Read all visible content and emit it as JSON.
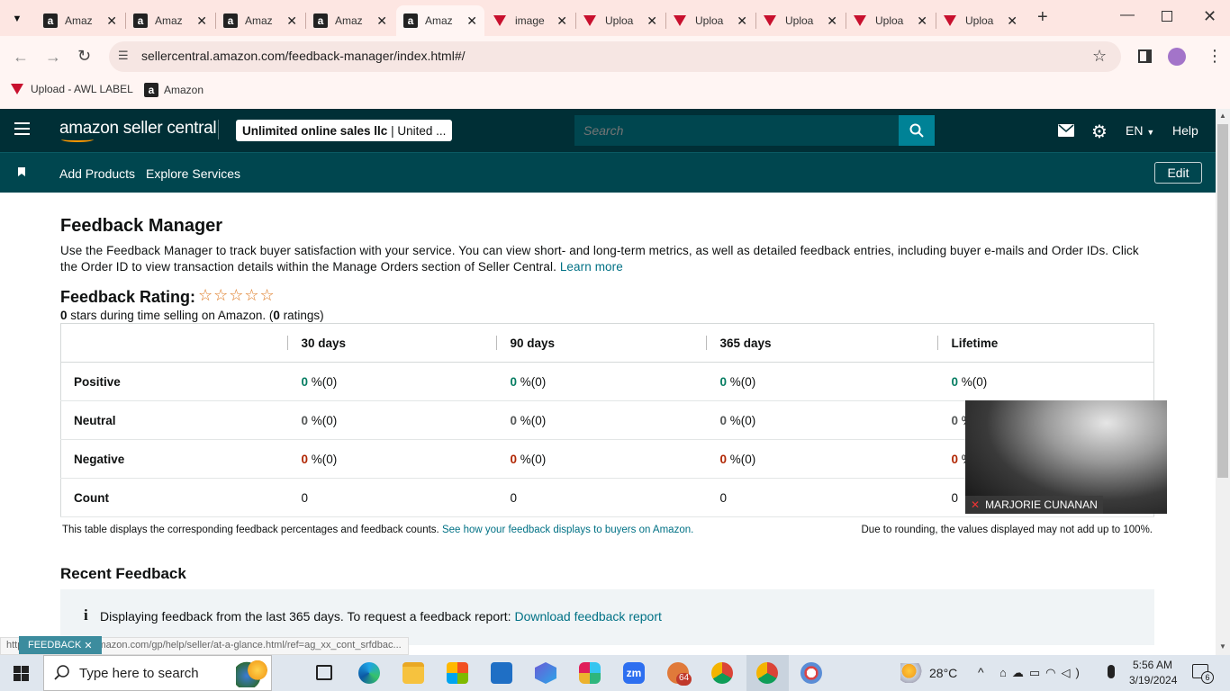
{
  "browser": {
    "tabs": [
      {
        "title": "Amaz",
        "icon": "amazon-icon",
        "active": false
      },
      {
        "title": "Amaz",
        "icon": "amazon-icon",
        "active": false
      },
      {
        "title": "Amaz",
        "icon": "amazon-icon",
        "active": false
      },
      {
        "title": "Amaz",
        "icon": "amazon-icon",
        "active": false
      },
      {
        "title": "Amaz",
        "icon": "amazon-icon",
        "active": true
      },
      {
        "title": "image",
        "icon": "upload-icon",
        "active": false
      },
      {
        "title": "Uploa",
        "icon": "upload-icon",
        "active": false
      },
      {
        "title": "Uploa",
        "icon": "upload-icon",
        "active": false
      },
      {
        "title": "Uploa",
        "icon": "upload-icon",
        "active": false
      },
      {
        "title": "Uploa",
        "icon": "upload-icon",
        "active": false
      },
      {
        "title": "Uploa",
        "icon": "upload-icon",
        "active": false
      }
    ],
    "url": "sellercentral.amazon.com/feedback-manager/index.html#/",
    "bookmarks": [
      "Upload - AWL LABEL",
      "Amazon"
    ],
    "status_url": "https://sellercentral.amazon.com/gp/help/seller/at-a-glance.html/ref=ag_xx_cont_srfdbac..."
  },
  "header": {
    "logo": "amazon seller central",
    "account": "Unlimited online sales llc",
    "account_region": "| United ...",
    "search_placeholder": "Search",
    "language": "EN",
    "help": "Help"
  },
  "nav": {
    "items": [
      "Add Products",
      "Explore Services"
    ],
    "edit": "Edit"
  },
  "page": {
    "title": "Feedback Manager",
    "description": "Use the Feedback Manager to track buyer satisfaction with your service. You can view short- and long-term metrics, as well as detailed feedback entries, including buyer e-mails and Order IDs. Click the Order ID to view transaction details within the Manage Orders section of Seller Central.",
    "learn_more": "Learn more",
    "rating_title": "Feedback Rating:",
    "stars": "☆☆☆☆☆",
    "stars_count": "0",
    "stars_text": " stars during time selling on Amazon. (",
    "ratings_count": "0",
    "ratings_text": " ratings)",
    "table": {
      "columns": [
        "30 days",
        "90 days",
        "365 days",
        "Lifetime"
      ],
      "rows": [
        {
          "label": "Positive",
          "cells": [
            "0",
            "0",
            "0",
            "0"
          ],
          "suffix": " %(0)"
        },
        {
          "label": "Neutral",
          "cells": [
            "0",
            "0",
            "0",
            "0"
          ],
          "suffix": " %(0)"
        },
        {
          "label": "Negative",
          "cells": [
            "0",
            "0",
            "0",
            "0"
          ],
          "suffix": " %(0)"
        },
        {
          "label": "Count",
          "cells": [
            "0",
            "0",
            "0",
            "0"
          ],
          "suffix": ""
        }
      ]
    },
    "table_note": "This table displays the corresponding feedback percentages and feedback counts.",
    "table_note_link": "See how your feedback displays to buyers on Amazon.",
    "rounding_note": "Due to rounding, the values displayed may not add up to 100%.",
    "recent_title": "Recent Feedback",
    "info_text": "Displaying feedback from the last 365 days. To request a feedback report:",
    "info_link": "Download feedback report",
    "feedback_button": "FEEDBACK"
  },
  "video": {
    "participant": "MARJORIE CUNANAN"
  },
  "taskbar": {
    "search_placeholder": "Type here to search",
    "temperature": "28°C",
    "time": "5:56 AM",
    "date": "3/19/2024",
    "notifications": "6",
    "chrome_badge": "64"
  },
  "colors": {
    "header": "#002f36",
    "nav": "#00464f",
    "search_button": "#008296",
    "link": "#007185"
  }
}
